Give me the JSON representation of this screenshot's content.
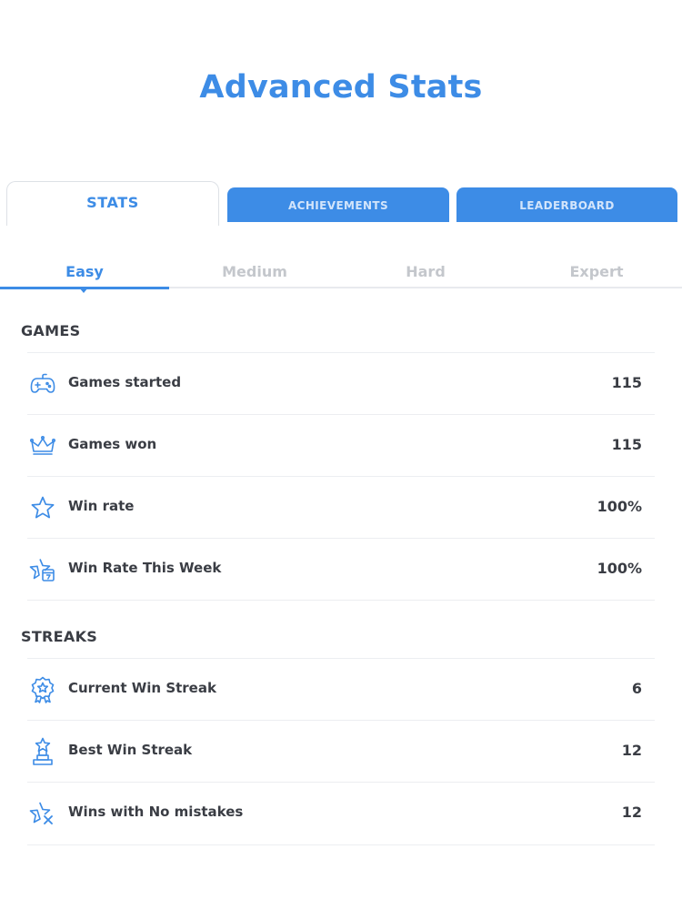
{
  "header": {
    "title": "Advanced Stats"
  },
  "tabs": [
    {
      "label": "STATS",
      "active": true
    },
    {
      "label": "ACHIEVEMENTS",
      "active": false
    },
    {
      "label": "LEADERBOARD",
      "active": false
    }
  ],
  "difficulty": [
    {
      "label": "Easy",
      "active": true
    },
    {
      "label": "Medium",
      "active": false
    },
    {
      "label": "Hard",
      "active": false
    },
    {
      "label": "Expert",
      "active": false
    }
  ],
  "sections": {
    "games": {
      "title": "GAMES",
      "rows": [
        {
          "icon": "gamepad-icon",
          "label": "Games started",
          "value": "115"
        },
        {
          "icon": "crown-icon",
          "label": "Games won",
          "value": "115"
        },
        {
          "icon": "star-icon",
          "label": "Win rate",
          "value": "100%"
        },
        {
          "icon": "star-calendar-icon",
          "label": "Win Rate This Week",
          "value": "100%"
        }
      ]
    },
    "streaks": {
      "title": "STREAKS",
      "rows": [
        {
          "icon": "medal-icon",
          "label": "Current Win Streak",
          "value": "6"
        },
        {
          "icon": "trophy-icon",
          "label": "Best Win Streak",
          "value": "12"
        },
        {
          "icon": "star-cross-icon",
          "label": "Wins with No mistakes",
          "value": "12"
        }
      ]
    }
  },
  "colors": {
    "accent": "#3d8ce6",
    "text": "#3a3d44",
    "inactive_text": "#c4c7cc"
  }
}
